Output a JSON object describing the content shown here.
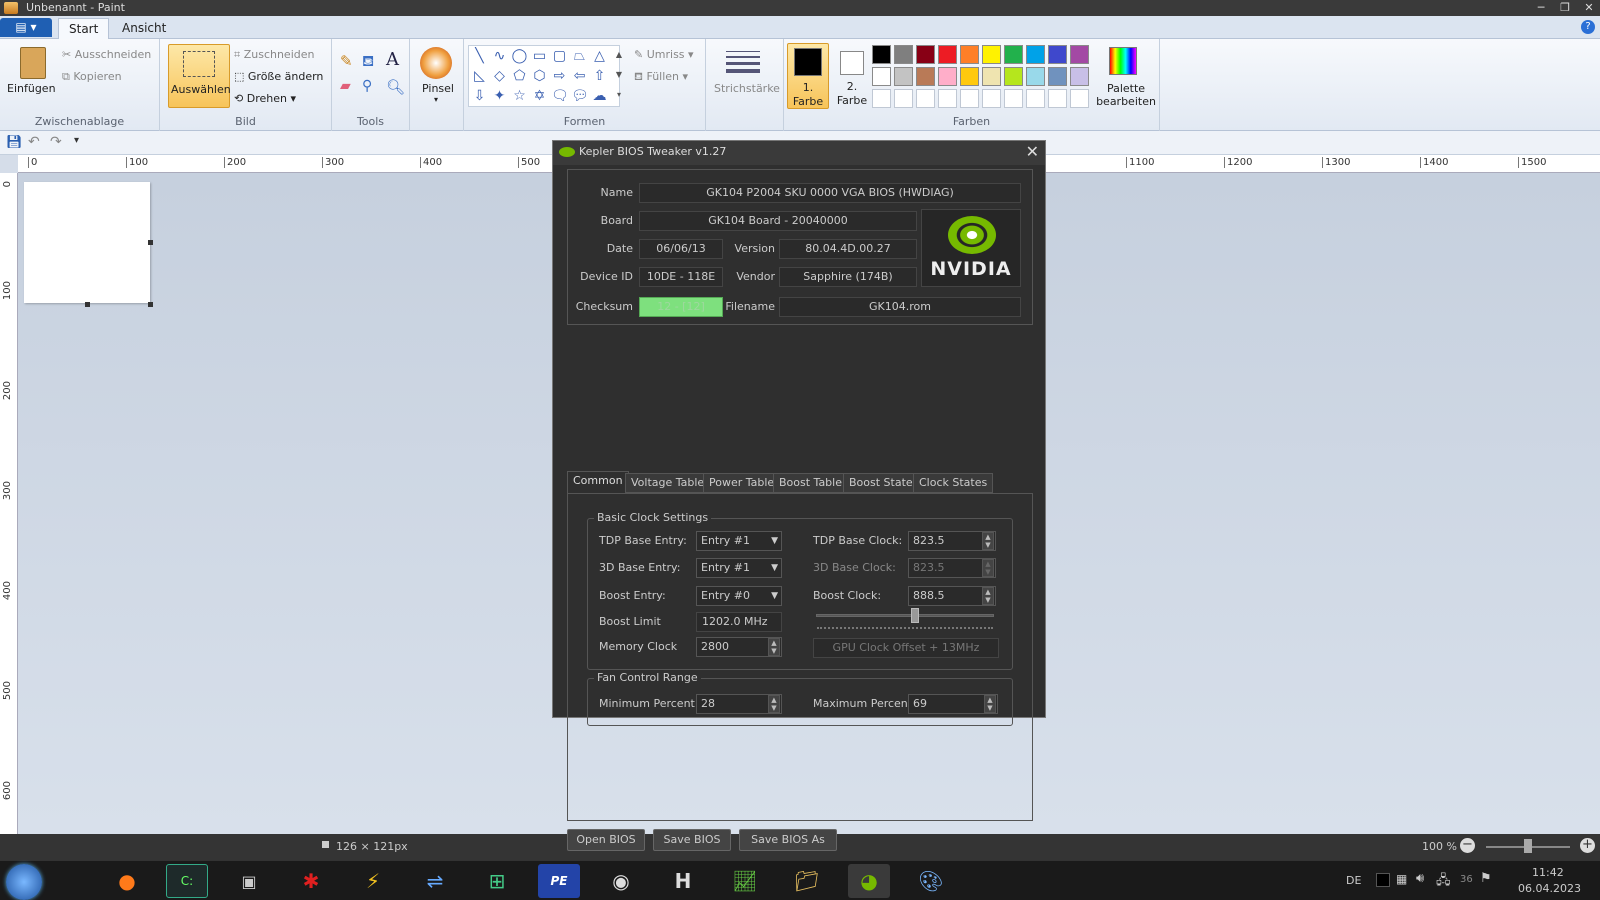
{
  "window": {
    "title": "Unbenannt - Paint"
  },
  "tabs": {
    "start": "Start",
    "view": "Ansicht"
  },
  "ribbon": {
    "clipboard": {
      "paste": "Einfügen",
      "cut": "Ausschneiden",
      "copy": "Kopieren",
      "group": "Zwischenablage"
    },
    "image": {
      "select": "Auswählen",
      "crop": "Zuschneiden",
      "resize": "Größe ändern",
      "rotate": "Drehen",
      "group": "Bild"
    },
    "tools": {
      "group": "Tools"
    },
    "brush": {
      "label": "Pinsel"
    },
    "shapes": {
      "outline": "Umriss",
      "fill": "Füllen",
      "group": "Formen"
    },
    "size": {
      "label": "Strichstärke"
    },
    "colors": {
      "color1_a": "1.",
      "color1_b": "Farbe",
      "color2_a": "2.",
      "color2_b": "Farbe",
      "edit_a": "Palette",
      "edit_b": "bearbeiten",
      "group": "Farben",
      "row1": [
        "#000000",
        "#7f7f7f",
        "#880015",
        "#ed1c24",
        "#ff7f27",
        "#fff200",
        "#22b14c",
        "#00a2e8",
        "#3f48cc",
        "#a349a4"
      ],
      "row2": [
        "#ffffff",
        "#c3c3c3",
        "#b97a57",
        "#ffaec9",
        "#ffc90e",
        "#efe4b0",
        "#b5e61d",
        "#99d9ea",
        "#7092be",
        "#c8bfe7"
      ]
    }
  },
  "ruler": {
    "h": [
      "0",
      "100",
      "200",
      "300",
      "400",
      "500",
      "1100",
      "1200",
      "1300",
      "1400",
      "1500"
    ],
    "v": [
      "0",
      "100",
      "200",
      "300",
      "400",
      "500",
      "600"
    ]
  },
  "status": {
    "size": "126 × 121px",
    "zoom": "100 %"
  },
  "taskbar": {
    "lang": "DE",
    "time": "11:42",
    "date": "06.04.2023",
    "num": "36"
  },
  "dialog": {
    "title": "Kepler BIOS Tweaker v1.27",
    "labels": {
      "name": "Name",
      "board": "Board",
      "date": "Date",
      "version": "Version",
      "device_id": "Device ID",
      "vendor": "Vendor",
      "checksum": "Checksum",
      "filename": "Filename"
    },
    "values": {
      "name": "GK104 P2004 SKU 0000 VGA BIOS (HWDIAG)",
      "board": "GK104 Board - 20040000",
      "date": "06/06/13",
      "version": "80.04.4D.00.27",
      "device_id": "10DE - 118E",
      "vendor": "Sapphire (174B)",
      "checksum": "12 - [12]",
      "filename": "GK104.rom"
    },
    "logo": "NVIDIA",
    "tabs": [
      "Common",
      "Voltage Table",
      "Power Table",
      "Boost Table",
      "Boost States",
      "Clock States"
    ],
    "basic": {
      "legend": "Basic Clock Settings",
      "tdp_entry_label": "TDP Base Entry:",
      "tdp_entry": "Entry #1",
      "d3_entry_label": "3D Base Entry:",
      "d3_entry": "Entry #1",
      "boost_entry_label": "Boost Entry:",
      "boost_entry": "Entry #0",
      "boost_limit_label": "Boost Limit",
      "boost_limit": "1202.0 MHz",
      "memory_label": "Memory Clock",
      "memory": "2800",
      "tdp_clock_label": "TDP Base Clock:",
      "tdp_clock": "823.5",
      "d3_clock_label": "3D Base Clock:",
      "d3_clock": "823.5",
      "boost_clock_label": "Boost Clock:",
      "boost_clock": "888.5",
      "offset": "GPU Clock Offset + 13MHz"
    },
    "fan": {
      "legend": "Fan Control Range",
      "min_label": "Minimum Percent:",
      "min": "28",
      "max_label": "Maximum Percent:",
      "max": "69"
    },
    "buttons": {
      "open": "Open BIOS",
      "save": "Save BIOS",
      "save_as": "Save BIOS As"
    }
  }
}
